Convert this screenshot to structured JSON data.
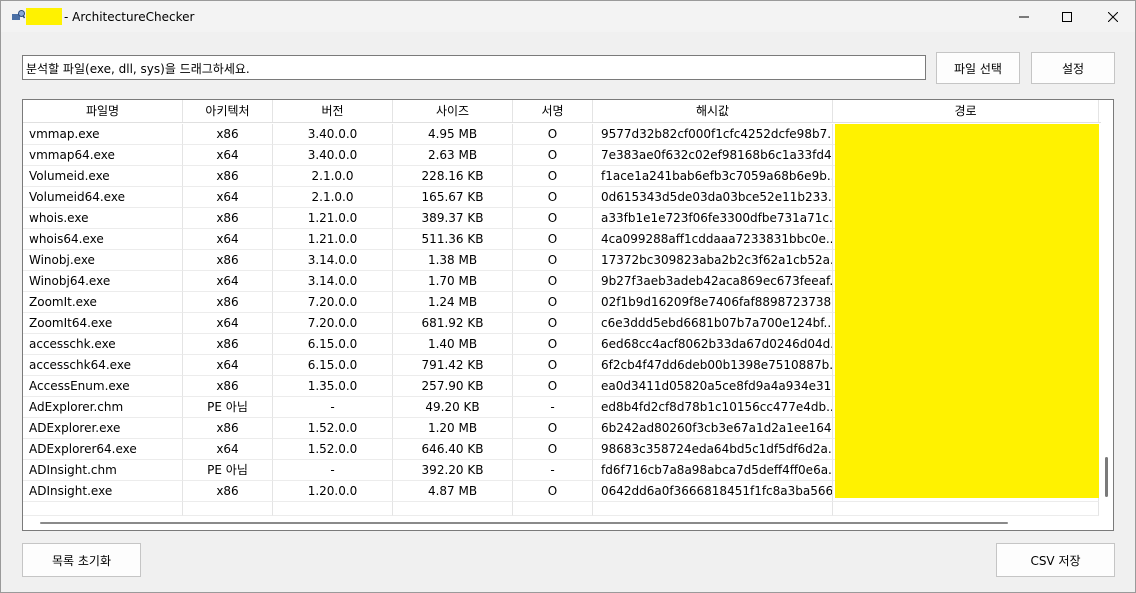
{
  "window": {
    "title": "- ArchitectureChecker",
    "controls": {
      "minimize": "minimize-icon",
      "maximize": "maximize-icon",
      "close": "close-icon"
    },
    "redaction_color": "#fff200"
  },
  "toolbar": {
    "drop_hint": "분석할 파일(exe, dll, sys)을 드래그하세요.",
    "select_file_label": "파일 선택",
    "settings_label": "설정"
  },
  "table": {
    "columns": [
      "파일명",
      "아키텍처",
      "버전",
      "사이즈",
      "서명",
      "해시값",
      "경로"
    ],
    "rows": [
      [
        "vmmap.exe",
        "x86",
        "3.40.0.0",
        "4.95 MB",
        "O",
        "9577d32b82cf000f1cfc4252dcfe98b7..."
      ],
      [
        "vmmap64.exe",
        "x64",
        "3.40.0.0",
        "2.63 MB",
        "O",
        "7e383ae0f632c02ef98168b6c1a33fd4..."
      ],
      [
        "Volumeid.exe",
        "x86",
        "2.1.0.0",
        "228.16 KB",
        "O",
        "f1ace1a241bab6efb3c7059a68b6e9b..."
      ],
      [
        "Volumeid64.exe",
        "x64",
        "2.1.0.0",
        "165.67 KB",
        "O",
        "0d615343d5de03da03bce52e11b233..."
      ],
      [
        "whois.exe",
        "x86",
        "1.21.0.0",
        "389.37 KB",
        "O",
        "a33fb1e1e723f06fe3300dfbe731a71c..."
      ],
      [
        "whois64.exe",
        "x64",
        "1.21.0.0",
        "511.36 KB",
        "O",
        "4ca099288aff1cddaaa7233831bbc0e..."
      ],
      [
        "Winobj.exe",
        "x86",
        "3.14.0.0",
        "1.38 MB",
        "O",
        "17372bc309823aba2b2c3f62a1cb52a..."
      ],
      [
        "Winobj64.exe",
        "x64",
        "3.14.0.0",
        "1.70 MB",
        "O",
        "9b27f3aeb3adeb42aca869ec673feeaf..."
      ],
      [
        "ZoomIt.exe",
        "x86",
        "7.20.0.0",
        "1.24 MB",
        "O",
        "02f1b9d16209f8e7406faf8898723738..."
      ],
      [
        "ZoomIt64.exe",
        "x64",
        "7.20.0.0",
        "681.92 KB",
        "O",
        "c6e3ddd5ebd6681b07b7a700e124bf..."
      ],
      [
        "accesschk.exe",
        "x86",
        "6.15.0.0",
        "1.40 MB",
        "O",
        "6ed68cc4acf8062b33da67d0246d04d..."
      ],
      [
        "accesschk64.exe",
        "x64",
        "6.15.0.0",
        "791.42 KB",
        "O",
        "6f2cb4f47dd6deb00b1398e7510887b..."
      ],
      [
        "AccessEnum.exe",
        "x86",
        "1.35.0.0",
        "257.90 KB",
        "O",
        "ea0d3411d05820a5ce8fd9a4a934e31..."
      ],
      [
        "AdExplorer.chm",
        "PE 아님",
        "-",
        "49.20 KB",
        "-",
        "ed8b4fd2cf8d78b1c10156cc477e4db..."
      ],
      [
        "ADExplorer.exe",
        "x86",
        "1.52.0.0",
        "1.20 MB",
        "O",
        "6b242ad80260f3cb3e67a1d2a1ee164..."
      ],
      [
        "ADExplorer64.exe",
        "x64",
        "1.52.0.0",
        "646.40 KB",
        "O",
        "98683c358724eda64bd5c1df5df6d2a..."
      ],
      [
        "ADInsight.chm",
        "PE 아님",
        "-",
        "392.20 KB",
        "-",
        "fd6f716cb7a8a98abca7d5deff4ff0e6a..."
      ],
      [
        "ADInsight.exe",
        "x86",
        "1.20.0.0",
        "4.87 MB",
        "O",
        "0642dd6a0f3666818451f1fc8a3ba566..."
      ]
    ]
  },
  "footer": {
    "reset_label": "목록 초기화",
    "csv_label": "CSV 저장"
  }
}
